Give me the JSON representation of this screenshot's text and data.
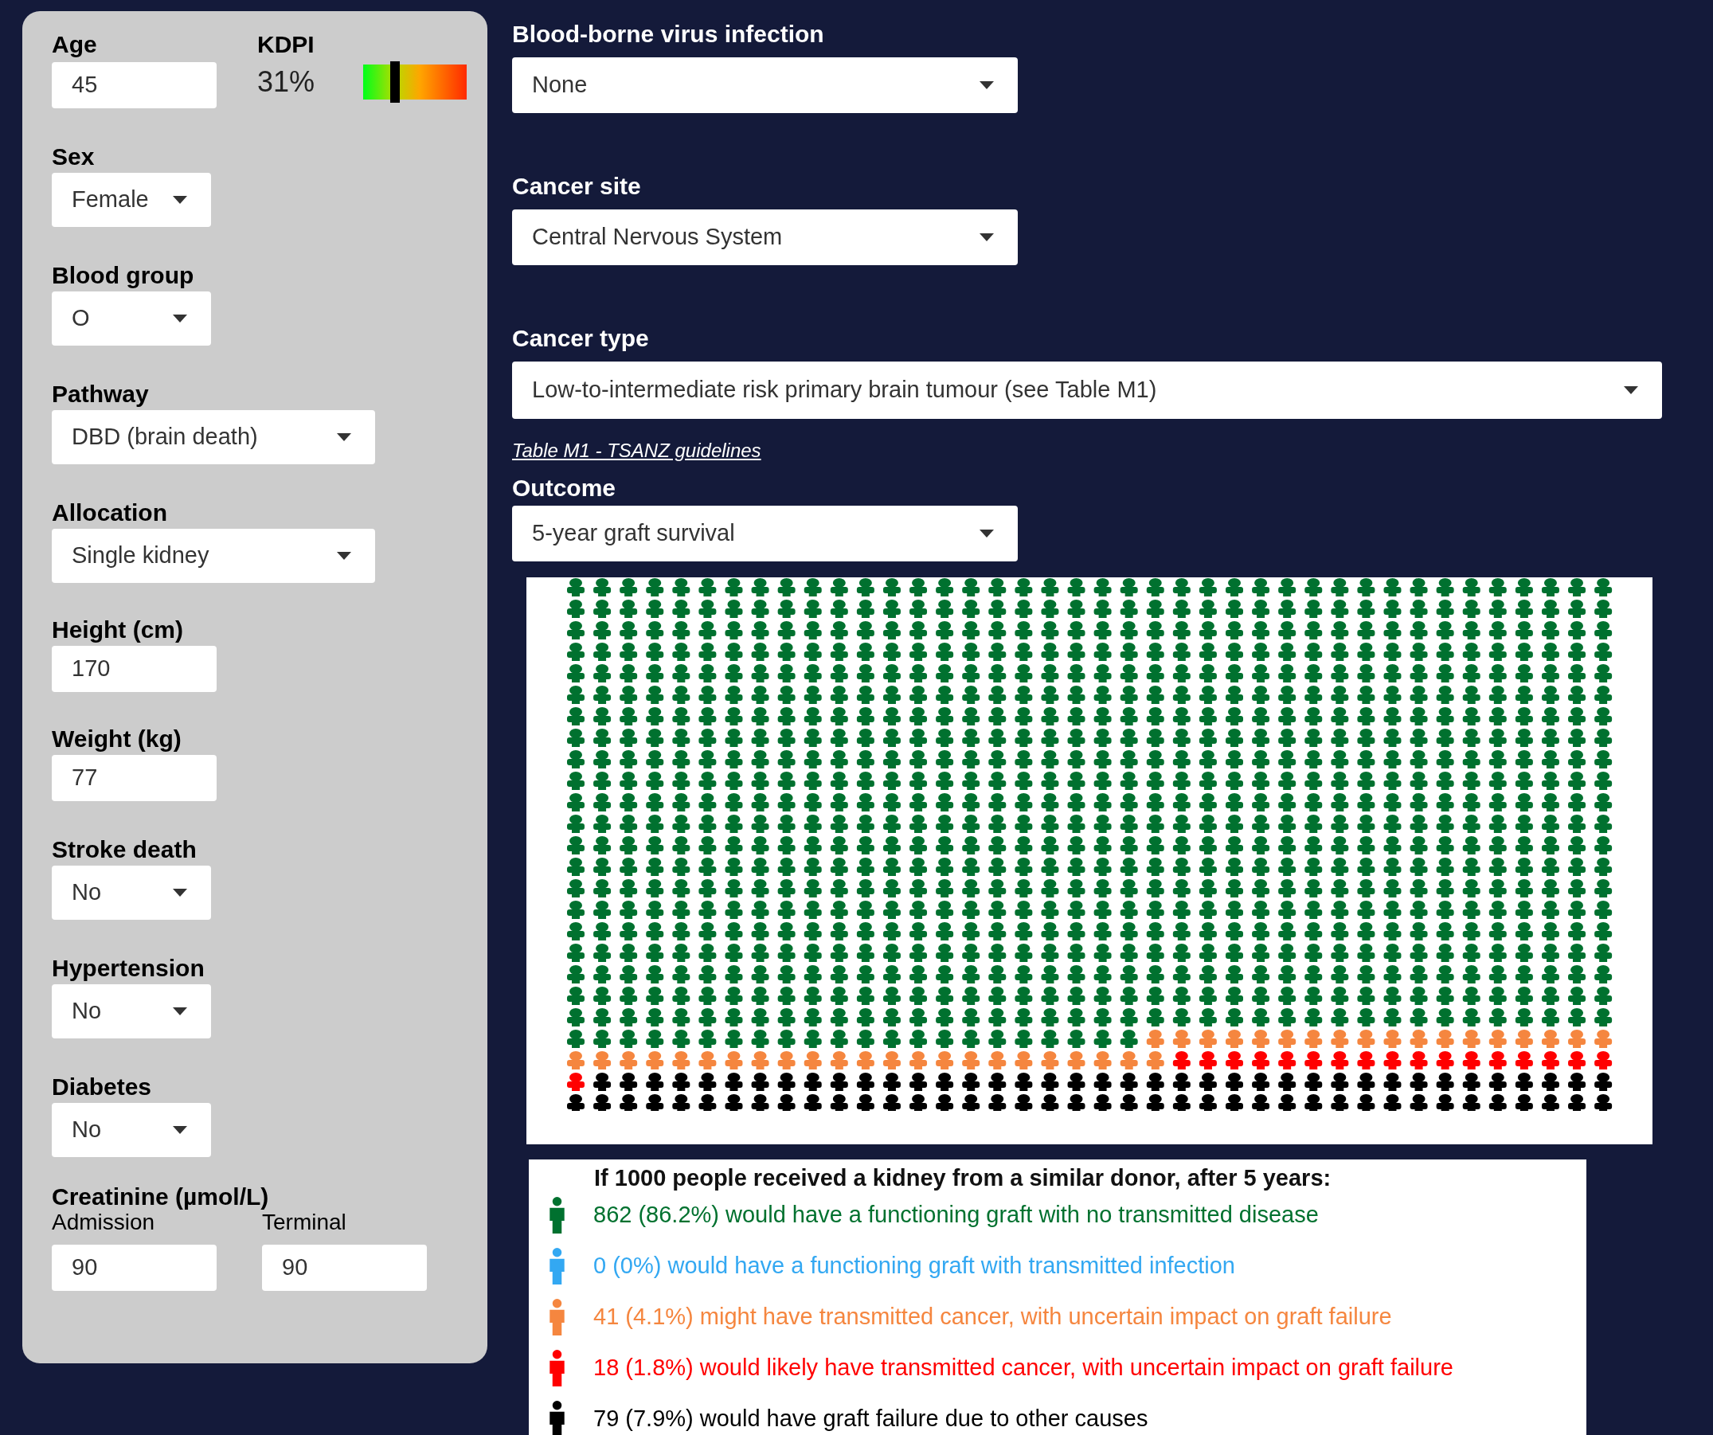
{
  "left_panel": {
    "age": {
      "label": "Age",
      "value": "45"
    },
    "kdpi": {
      "label": "KDPI",
      "value": "31%",
      "level": 0.31
    },
    "fields": [
      {
        "kind": "select",
        "label": "Sex",
        "value": "Female"
      },
      {
        "kind": "select",
        "label": "Blood group",
        "value": "O"
      },
      {
        "kind": "select-wide",
        "label": "Pathway",
        "value": "DBD (brain death)"
      },
      {
        "kind": "select-wide",
        "label": "Allocation",
        "value": "Single kidney"
      },
      {
        "kind": "input",
        "label": "Height (cm)",
        "value": "170"
      },
      {
        "kind": "input",
        "label": "Weight (kg)",
        "value": "77"
      },
      {
        "kind": "select",
        "label": "Stroke death",
        "value": "No"
      },
      {
        "kind": "select",
        "label": "Hypertension",
        "value": "No"
      },
      {
        "kind": "select",
        "label": "Diabetes",
        "value": "No"
      }
    ],
    "creatinine": {
      "label": "Creatinine (µmol/L)",
      "inputs": [
        {
          "label": "Admission",
          "value": "90"
        },
        {
          "label": "Terminal",
          "value": "90"
        }
      ]
    }
  },
  "main": {
    "selects": [
      {
        "label": "Blood-borne virus infection",
        "value": "None",
        "kind": "select"
      },
      {
        "label": "Cancer site",
        "value": "Central Nervous System",
        "kind": "select"
      },
      {
        "label": "Cancer type",
        "value": "Low-to-intermediate risk primary brain tumour (see Table M1)",
        "kind": "select-full"
      }
    ],
    "link": "Table M1 - TSANZ guidelines",
    "outcome": {
      "label": "Outcome",
      "value": "5-year graft survival"
    },
    "legend": {
      "title": "If 1000 people received a kidney from a similar donor, after 5 years:",
      "items": [
        {
          "count": "862",
          "text": "(86.2%) would have a functioning graft with no transmitted disease",
          "color": "#00712f"
        },
        {
          "count": "0",
          "text": "(0%) would have a functioning graft with transmitted infection",
          "color": "#33a8f2"
        },
        {
          "count": "41",
          "text": "(4.1%) might have transmitted cancer, with uncertain impact on graft failure",
          "color": "#f5863f"
        },
        {
          "count": "18",
          "text": "(1.8%) would likely have transmitted cancer, with uncertain impact on graft failure",
          "color": "#ff0000"
        },
        {
          "count": "79",
          "text": "(7.9%) would have graft failure due to other causes",
          "color": "#000000"
        }
      ]
    }
  }
}
